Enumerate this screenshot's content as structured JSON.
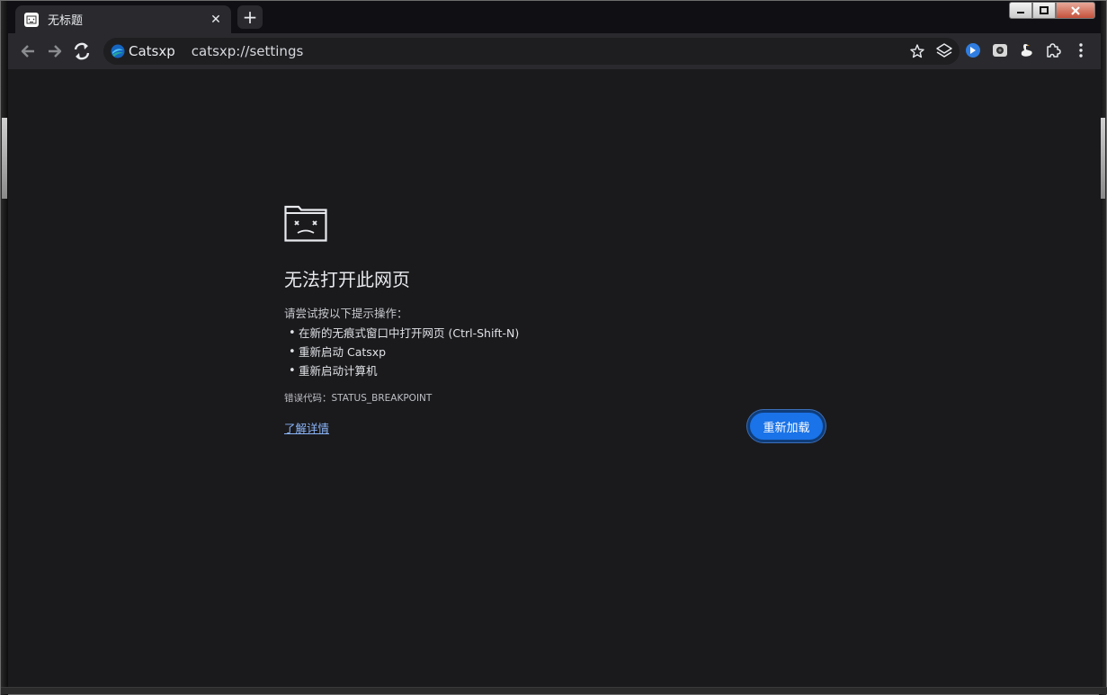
{
  "tab": {
    "title": "无标题",
    "close_glyph": "✕",
    "favicon": "sad-folder-icon"
  },
  "new_tab": {
    "glyph": "+"
  },
  "toolbar": {
    "site_name": "Catsxp",
    "url": "catsxp://settings",
    "icons": [
      "back-arrow-icon",
      "forward-arrow-icon",
      "reload-icon",
      "bookmark-star-icon",
      "layers-icon",
      "extension-blue-icon",
      "extension-camera-icon",
      "extension-goose-icon",
      "puzzle-icon",
      "kebab-menu-icon"
    ]
  },
  "error_page": {
    "title": "无法打开此网页",
    "suggestion_heading": "请尝试按以下提示操作：",
    "tips": [
      "在新的无痕式窗口中打开网页 (Ctrl-Shift-N)",
      "重新启动 Catsxp",
      "重新启动计算机"
    ],
    "error_code": "错误代码：STATUS_BREAKPOINT",
    "learn_more": "了解详情",
    "reload_label": "重新加载"
  },
  "colors": {
    "page_bg": "#1a1a1d",
    "toolbar_bg": "#2a2a2e",
    "accent_button": "#1a73e8",
    "link": "#8ab4f8"
  }
}
